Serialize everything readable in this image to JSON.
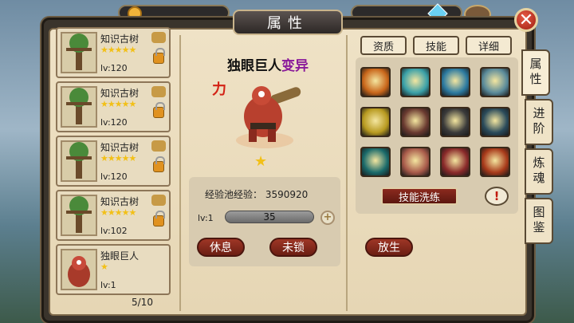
{
  "title": "属性",
  "close_label": "✕",
  "hero_list": [
    {
      "name": "知识古树",
      "stars": "★★★★★",
      "level": "lv:120",
      "locked": true
    },
    {
      "name": "知识古树",
      "stars": "★★★★★",
      "level": "lv:120",
      "locked": true
    },
    {
      "name": "知识古树",
      "stars": "★★★★★",
      "level": "lv:120",
      "locked": true
    },
    {
      "name": "知识古树",
      "stars": "★★★★★",
      "level": "lv:102",
      "locked": true
    },
    {
      "name": "独眼巨人",
      "stars": "★",
      "level": "lv:1",
      "locked": false
    }
  ],
  "page_indicator": "5/10",
  "hero": {
    "name": "独眼巨人",
    "mutation": "变异",
    "attribute": "力",
    "stars": "★"
  },
  "exp_pool": "经验池经验： 3590920",
  "level_label": "lv:1",
  "level_progress": "35",
  "buttons": {
    "rest": "休息",
    "unlock": "未锁",
    "release": "放生",
    "plus": "+"
  },
  "skill_tabs": [
    "资质",
    "技能",
    "详细"
  ],
  "skill_reset": "技能洗练",
  "info_button": "!",
  "side_tabs": [
    "属性",
    "进阶",
    "炼魂",
    "图鉴"
  ],
  "skills": [
    {
      "icon": "fire-warrior-skill-icon",
      "color": "#c9661a"
    },
    {
      "icon": "ice-blade-skill-icon",
      "color": "#3aa0a8"
    },
    {
      "icon": "blue-shield-skill-icon",
      "color": "#2c7aa0"
    },
    {
      "icon": "axe-skill-icon",
      "color": "#5a8a9a"
    },
    {
      "icon": "gold-strike-skill-icon",
      "color": "#b89a20"
    },
    {
      "icon": "red-claw-skill-icon",
      "color": "#6a3a30"
    },
    {
      "icon": "shadow-skill-icon",
      "color": "#3a3a3a"
    },
    {
      "icon": "duo-fighter-skill-icon",
      "color": "#2a4a5a"
    },
    {
      "icon": "teal-dash-skill-icon",
      "color": "#1a6a6a"
    },
    {
      "icon": "red-orb-skill-icon",
      "color": "#a85a4a"
    },
    {
      "icon": "web-skill-icon",
      "color": "#8a2a2a"
    },
    {
      "icon": "fist-skill-icon",
      "color": "#a83a1a"
    }
  ]
}
